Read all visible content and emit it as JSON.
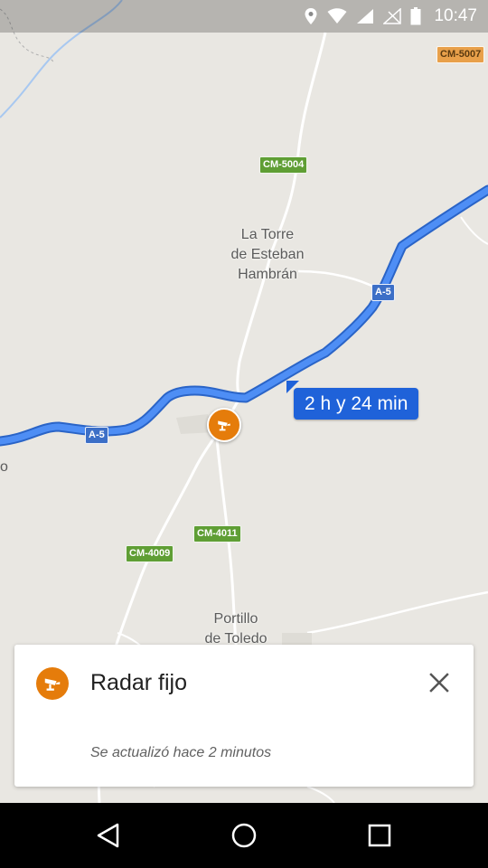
{
  "status_bar": {
    "time": "10:47",
    "icons": [
      "location-icon",
      "wifi-icon",
      "signal-icon",
      "signal-off-icon",
      "battery-icon"
    ]
  },
  "map": {
    "road_labels": {
      "cm5007": "CM-5007",
      "cm5004": "CM-5004",
      "a5_east": "A-5",
      "a5_west": "A-5",
      "cm4011": "CM-4011",
      "cm4009": "CM-4009"
    },
    "towns": {
      "torre_line1": "La Torre",
      "torre_line2": "de Esteban",
      "torre_line3": "Hambrán",
      "portillo_line1": "Portillo",
      "portillo_line2": "de Toledo"
    },
    "edge_label": "o",
    "route_eta": "2 h y 24 min",
    "route_color": "#4285f4",
    "eta_color": "#1f62d9",
    "radar_color": "#e57c0b"
  },
  "info_card": {
    "title": "Radar fijo",
    "subtitle": "Se actualizó hace 2 minutos",
    "icon": "speed-camera-icon",
    "close_icon": "close-icon"
  },
  "nav_bar": {
    "buttons": [
      "back-icon",
      "home-icon",
      "recents-icon"
    ]
  }
}
